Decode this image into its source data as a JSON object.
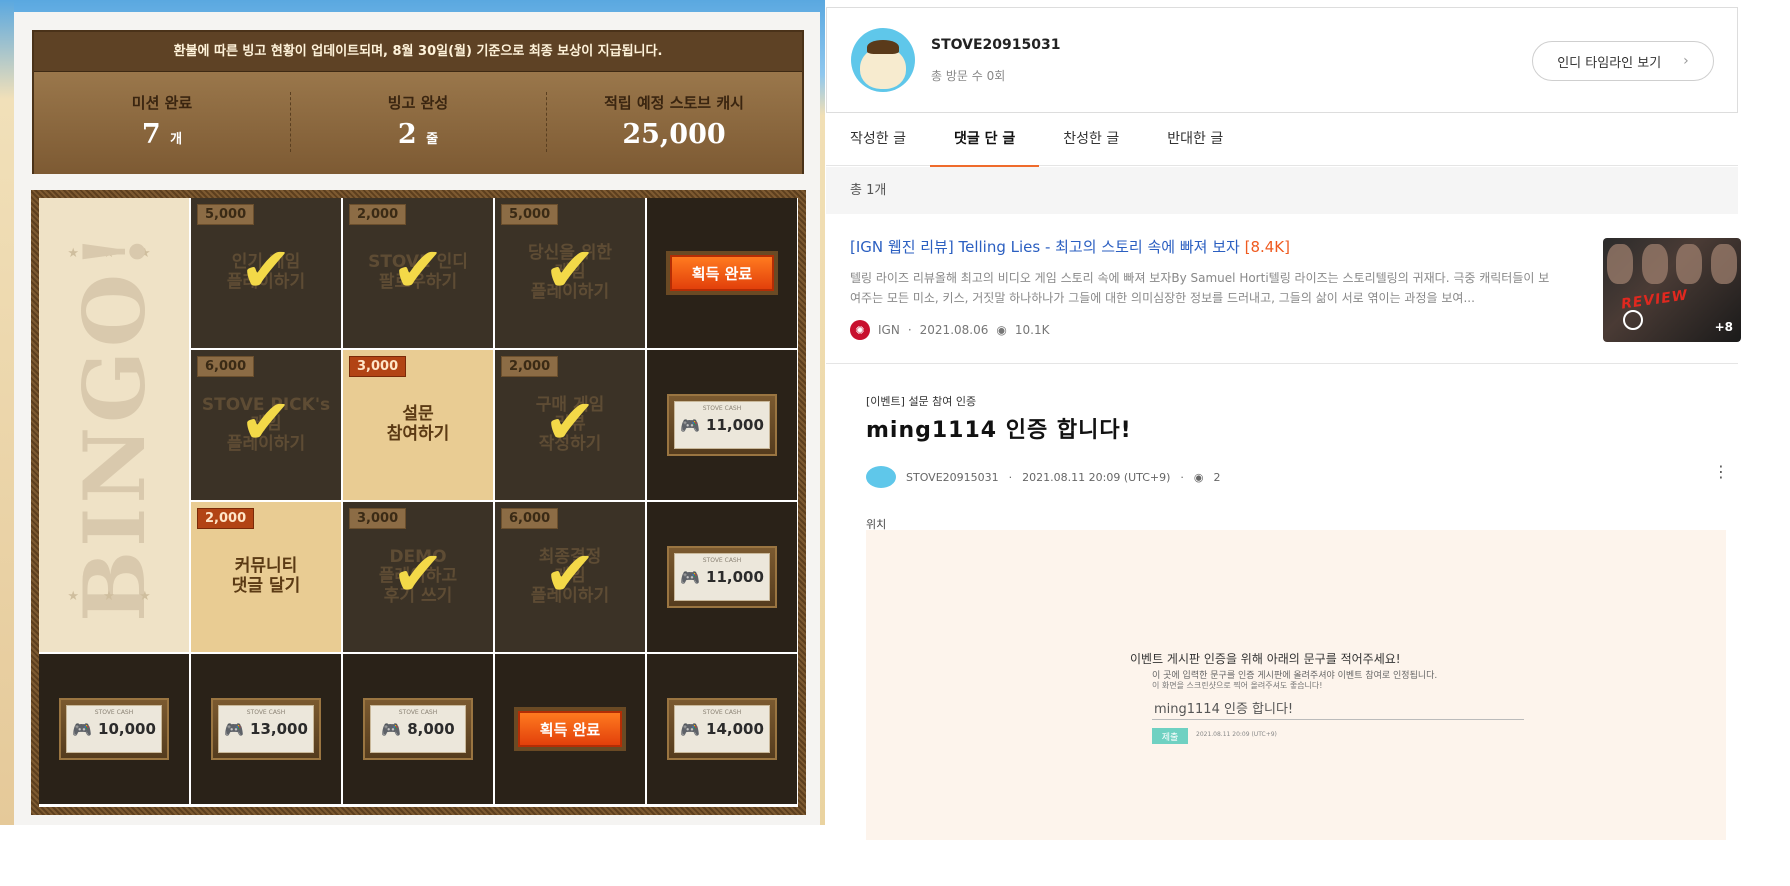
{
  "bingo": {
    "notice": "환불에 따른 빙고 현황이 업데이트되며, 8월 30일(월) 기준으로 최종 보상이 지급됩니다.",
    "stats": [
      {
        "label": "미션 완료",
        "value": "7",
        "unit": "개"
      },
      {
        "label": "빙고 완성",
        "value": "2",
        "unit": "줄"
      },
      {
        "label": "적립 예정 스토브 캐시",
        "value": "25,000",
        "unit": ""
      }
    ],
    "side_label": "BINGO!",
    "stars": "★ ★ ★",
    "check_glyph": "✔",
    "claimed_label": "획득 완료",
    "cash_label": "STOVE CASH",
    "row1": [
      {
        "points": "5,000",
        "text": "인기 게임\n플레이하기",
        "done": true
      },
      {
        "points": "2,000",
        "text": "STOVE 인디\n팔로우하기",
        "done": true
      },
      {
        "points": "5,000",
        "text": "당신을 위한\n게임\n플레이하기",
        "done": true
      }
    ],
    "row2": [
      {
        "points": "6,000",
        "text": "STOVE PICK's\n게임\n플레이하기",
        "done": true
      },
      {
        "points": "3,000",
        "text": "설문\n참여하기",
        "done": false
      },
      {
        "points": "2,000",
        "text": "구매 게임\n리뷰\n작성하기",
        "done": true
      }
    ],
    "row3": [
      {
        "points": "2,000",
        "text": "커뮤니티\n댓글 달기",
        "done": false
      },
      {
        "points": "3,000",
        "text": "DEMO\n플레이하고\n후기 쓰기",
        "done": true
      },
      {
        "points": "6,000",
        "text": "최종결정\n게임\n플레이하기",
        "done": true
      }
    ],
    "rewards_right": [
      "11,000",
      "11,000"
    ],
    "rewards_bottom": [
      "10,000",
      "13,000",
      "8,000",
      "14,000"
    ]
  },
  "profile": {
    "name": "STOVE20915031",
    "visits": "총 방문 수 0회",
    "indie_button": "인디 타임라인 보기",
    "chevron": "›"
  },
  "tabs": [
    "작성한 글",
    "댓글 단 글",
    "찬성한 글",
    "반대한 글"
  ],
  "total": "총 1개",
  "post": {
    "title": "[IGN 웹진 리뷰] Telling Lies - 최고의 스토리 속에 빠져 보자",
    "count": "[8.4K]",
    "excerpt": "텔링 라이즈 리뷰올해 최고의 비디오 게임 스토리 속에 빠져 보자By Samuel Horti텔링 라이즈는 스토리텔링의 귀재다. 극중 캐릭터들이 보여주는 모든 미소, 키스, 거짓말 하나하나가 그들에 대한 의미심장한 정보를 드러내고, 그들의 삶이 서로 엮이는 과정을 보여...",
    "source": "IGN",
    "date": "2021.08.06",
    "views": "10.1K",
    "thumb_text": "REVIEW",
    "thumb_more": "+8"
  },
  "embed": {
    "category": "[이벤트] 설문 참여 인증",
    "title": "ming1114 인증 합니다!",
    "author": "STOVE20915031",
    "datetime": "2021.08.11 20:09 (UTC+9)",
    "views": "2",
    "label": "위치",
    "form_line1": "이벤트 게시판 인증을 위해 아래의 문구를 적어주세요!",
    "form_line2": "이 곳에 입력한 문구를 인증 게시판에 올려주셔야 이벤트 참여로 인정됩니다.",
    "form_line3": "이 화면을 스크린샷으로 찍어 올려주셔도 좋습니다!",
    "form_input": "ming1114 인증 합니다!",
    "submit": "제출",
    "hint": "2021.08.11 20:09 (UTC+9)"
  }
}
